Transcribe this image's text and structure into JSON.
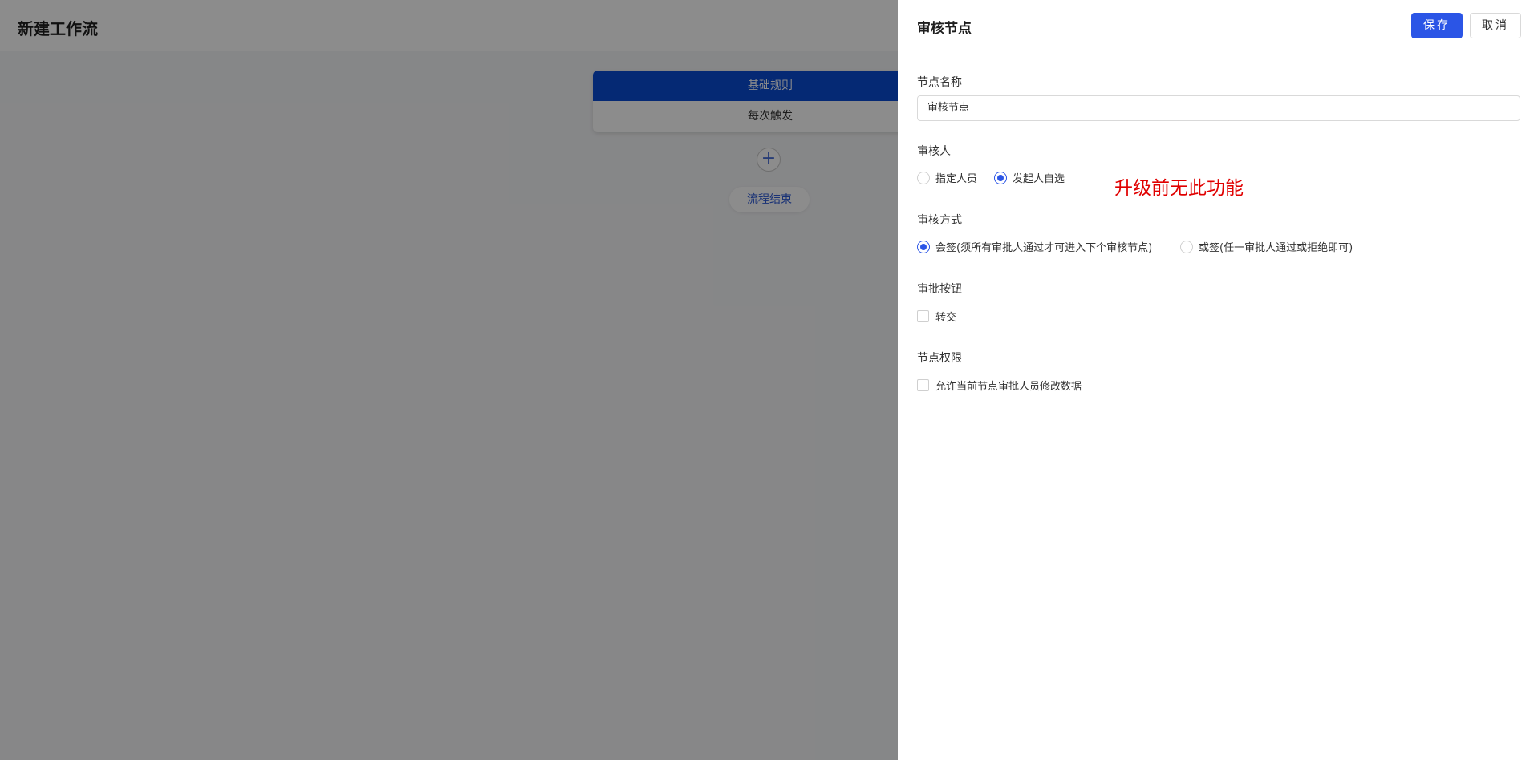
{
  "page": {
    "title": "新建工作流"
  },
  "flow": {
    "trigger_title": "基础规则",
    "trigger_body": "每次触发",
    "add_symbol": "+",
    "end_label": "流程结束"
  },
  "drawer": {
    "title": "审核节点",
    "save_label": "保存",
    "cancel_label": "取消",
    "node_name": {
      "label": "节点名称",
      "value": "审核节点"
    },
    "reviewer": {
      "label": "审核人",
      "options": [
        {
          "label": "指定人员",
          "checked": false
        },
        {
          "label": "发起人自选",
          "checked": true
        }
      ]
    },
    "annotation": "升级前无此功能",
    "review_mode": {
      "label": "审核方式",
      "options": [
        {
          "label": "会签(须所有审批人通过才可进入下个审核节点)",
          "checked": true
        },
        {
          "label": "或签(任一审批人通过或拒绝即可)",
          "checked": false
        }
      ]
    },
    "approve_buttons": {
      "label": "审批按钮",
      "options": [
        {
          "label": "转交",
          "checked": false
        }
      ]
    },
    "node_permission": {
      "label": "节点权限",
      "options": [
        {
          "label": "允许当前节点审批人员修改数据",
          "checked": false
        }
      ]
    }
  },
  "colors": {
    "accent": "#2b55e6",
    "trigger_header": "#0a4bd4",
    "annotation": "#e00000"
  }
}
